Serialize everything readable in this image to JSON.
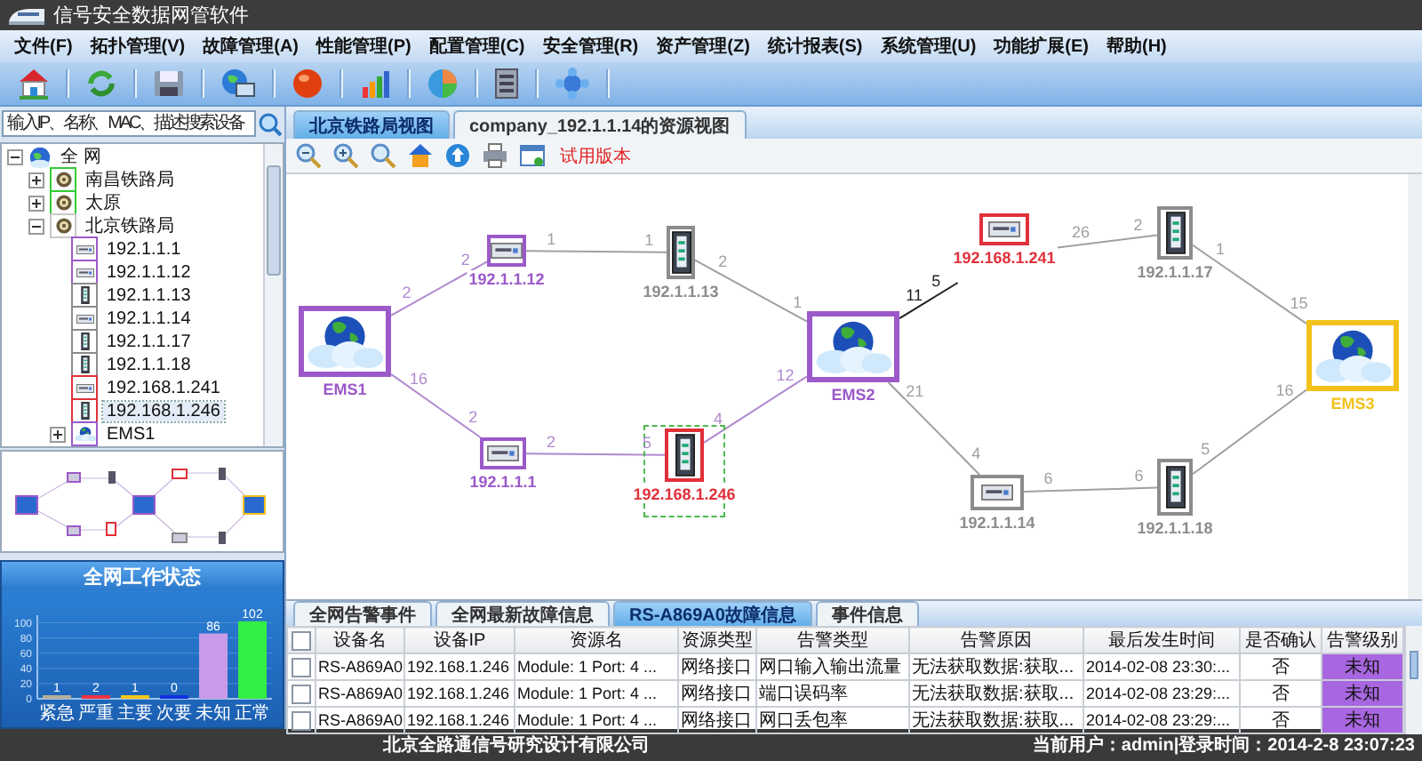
{
  "window": {
    "title": "信号安全数据网管软件"
  },
  "menu": [
    "文件(F)",
    "拓扑管理(V)",
    "故障管理(A)",
    "性能管理(P)",
    "配置管理(C)",
    "安全管理(R)",
    "资产管理(Z)",
    "统计报表(S)",
    "系统管理(U)",
    "功能扩展(E)",
    "帮助(H)"
  ],
  "search": {
    "placeholder": "输入IP、名称、MAC、描述搜索设备"
  },
  "tree": [
    {
      "label": "全 网",
      "kind": "network",
      "expanded": true,
      "selected": false,
      "children": [
        {
          "label": "南昌铁路局",
          "kind": "bureau",
          "color": "#33cc33",
          "expanded": false,
          "selected": false
        },
        {
          "label": "太原",
          "kind": "bureau",
          "color": "#33cc33",
          "expanded": false,
          "selected": false
        },
        {
          "label": "北京铁路局",
          "kind": "bureau",
          "color": "#c8c8c8",
          "expanded": true,
          "selected": false,
          "children": [
            {
              "label": "192.1.1.1",
              "kind": "flat",
              "color": "#9b59c9",
              "selected": false
            },
            {
              "label": "192.1.1.12",
              "kind": "flat",
              "color": "#9b59c9",
              "selected": false
            },
            {
              "label": "192.1.1.13",
              "kind": "tall",
              "color": "#8c8c8c",
              "selected": false
            },
            {
              "label": "192.1.1.14",
              "kind": "flat",
              "color": "#8c8c8c",
              "selected": false
            },
            {
              "label": "192.1.1.17",
              "kind": "tall",
              "color": "#8c8c8c",
              "selected": false
            },
            {
              "label": "192.1.1.18",
              "kind": "tall",
              "color": "#8c8c8c",
              "selected": false
            },
            {
              "label": "192.168.1.241",
              "kind": "flat",
              "color": "#e0303a",
              "selected": false
            },
            {
              "label": "192.168.1.246",
              "kind": "tall",
              "color": "#e0303a",
              "selected": true
            },
            {
              "label": "EMS1",
              "kind": "cloud",
              "color": "#9b59c9",
              "expanded": false,
              "selected": false
            }
          ]
        }
      ]
    }
  ],
  "status_panel": {
    "title": "全网工作状态",
    "chart_data": {
      "type": "bar",
      "categories": [
        "紧急",
        "严重",
        "主要",
        "次要",
        "未知",
        "正常"
      ],
      "stacked": true,
      "grid": true,
      "ylim": [
        0,
        110
      ],
      "yticks": [
        0,
        20,
        40,
        60,
        80,
        100
      ],
      "data_labels": true,
      "series": [
        {
          "color": "#b8ad9a",
          "values": [
            1,
            null,
            null,
            null,
            null,
            null
          ]
        },
        {
          "color": "#ee3344",
          "values": [
            null,
            2,
            null,
            null,
            null,
            null
          ]
        },
        {
          "color": "#f5c518",
          "values": [
            null,
            null,
            1,
            null,
            null,
            null
          ]
        },
        {
          "color": "#1030e0",
          "values": [
            null,
            null,
            null,
            0,
            null,
            null
          ]
        },
        {
          "color": "#c89be8",
          "values": [
            null,
            null,
            null,
            null,
            86,
            null
          ]
        },
        {
          "color": "#33ee44",
          "values": [
            null,
            null,
            null,
            null,
            null,
            102
          ]
        }
      ]
    }
  },
  "view_tabs": [
    {
      "label": "北京铁路局视图",
      "selected": true
    },
    {
      "label": "company_192.1.1.14的资源视图",
      "selected": false
    }
  ],
  "trial_label": "试用版本",
  "diagram": {
    "nodes": [
      {
        "label": "EMS1",
        "kind": "cloud",
        "color": "#9b59c9",
        "selected": false
      },
      {
        "label": "192.1.1.12",
        "kind": "flat",
        "color": "#9b59c9",
        "selected": false
      },
      {
        "label": "192.1.1.13",
        "kind": "tall",
        "color": "#8c8c8c",
        "selected": false
      },
      {
        "label": "EMS2",
        "kind": "cloud",
        "color": "#9b59c9",
        "selected": false
      },
      {
        "label": "192.168.1.241",
        "kind": "flat",
        "color": "#e0303a",
        "selected": false
      },
      {
        "label": "192.1.1.17",
        "kind": "tall",
        "color": "#8c8c8c",
        "selected": false
      },
      {
        "label": "EMS3",
        "kind": "cloud",
        "color": "#f2c21b",
        "selected": false
      },
      {
        "label": "192.1.1.1",
        "kind": "flat",
        "color": "#9b59c9",
        "selected": false
      },
      {
        "label": "192.168.1.246",
        "kind": "tall",
        "color": "#e0303a",
        "selected": true
      },
      {
        "label": "192.1.1.14",
        "kind": "flat",
        "color": "#8c8c8c",
        "selected": false
      },
      {
        "label": "192.1.1.18",
        "kind": "tall",
        "color": "#8c8c8c",
        "selected": false
      }
    ],
    "links": [
      {
        "from_port": "2",
        "to_port": "2",
        "color": "#b08ad0"
      },
      {
        "from_port": "1",
        "to_port": "1",
        "color": "#a0a0a0"
      },
      {
        "from_port": "2",
        "to_port": "1",
        "color": "#a0a0a0"
      },
      {
        "from_port": "16",
        "to_port": "2",
        "color": "#b08ad0"
      },
      {
        "from_port": "2",
        "to_port": "5",
        "color": "#b08ad0"
      },
      {
        "from_port": "4",
        "to_port": "12",
        "color": "#b08ad0"
      },
      {
        "from_port": "11",
        "to_port": "5",
        "color": "#222222"
      },
      {
        "from_port": "26",
        "to_port": "2",
        "color": "#a0a0a0"
      },
      {
        "from_port": "1",
        "to_port": "15",
        "color": "#a0a0a0"
      },
      {
        "from_port": "21",
        "to_port": "4",
        "color": "#a0a0a0"
      },
      {
        "from_port": "6",
        "to_port": "6",
        "color": "#a0a0a0"
      },
      {
        "from_port": "5",
        "to_port": "16",
        "color": "#a0a0a0"
      }
    ]
  },
  "bottom_tabs": [
    {
      "label": "全网告警事件",
      "selected": false
    },
    {
      "label": "全网最新故障信息",
      "selected": false
    },
    {
      "label": "RS-A869A0故障信息",
      "selected": true
    },
    {
      "label": "事件信息",
      "selected": false
    }
  ],
  "alarm_table": {
    "all_checked": false,
    "columns": [
      "设备名",
      "设备IP",
      "资源名",
      "资源类型",
      "告警类型",
      "告警原因",
      "最后发生时间",
      "是否确认",
      "告警级别"
    ],
    "rows": [
      {
        "checked": false,
        "color": "#a866e0",
        "cells": [
          "RS-A869A0",
          "192.168.1.246",
          "Module: 1 Port: 4 ...",
          "网络接口",
          "网口输入输出流量",
          "无法获取数据:获取...",
          "2014-02-08 23:30:...",
          "否",
          "未知"
        ]
      },
      {
        "checked": false,
        "color": "#a866e0",
        "cells": [
          "RS-A869A0",
          "192.168.1.246",
          "Module: 1 Port: 4 ...",
          "网络接口",
          "端口误码率",
          "无法获取数据:获取...",
          "2014-02-08 23:29:...",
          "否",
          "未知"
        ]
      },
      {
        "checked": false,
        "color": "#a866e0",
        "cells": [
          "RS-A869A0",
          "192.168.1.246",
          "Module: 1 Port: 4 ...",
          "网络接口",
          "网口丢包率",
          "无法获取数据:获取...",
          "2014-02-08 23:29:...",
          "否",
          "未知"
        ]
      }
    ]
  },
  "status_bar": {
    "company": "北京全路通信号研究设计有限公司",
    "session": "当前用户：admin|登录时间：2014-2-8 23:07:23"
  }
}
